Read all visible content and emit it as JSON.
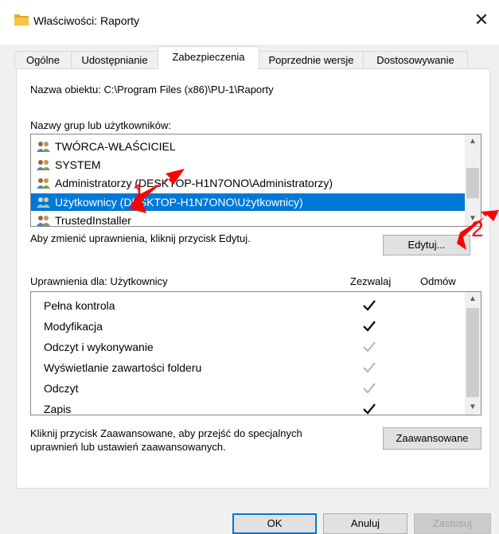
{
  "window": {
    "title": "Właściwości: Raporty",
    "close_glyph": "✕"
  },
  "tabs": [
    {
      "label": "Ogólne"
    },
    {
      "label": "Udostępnianie"
    },
    {
      "label": "Zabezpieczenia"
    },
    {
      "label": "Poprzednie wersje"
    },
    {
      "label": "Dostosowywanie"
    }
  ],
  "object_name": "Nazwa obiektu:  C:\\Program Files (x86)\\PU-1\\Raporty",
  "groups_label": "Nazwy grup lub użytkowników:",
  "groups": [
    {
      "name": "TWÓRCA-WŁAŚCICIEL",
      "icon": "users-icon"
    },
    {
      "name": "SYSTEM",
      "icon": "users-icon"
    },
    {
      "name": "Administratorzy (DESKTOP-H1N7ONO\\Administratorzy)",
      "icon": "users-icon"
    },
    {
      "name": "Użytkownicy (DESKTOP-H1N7ONO\\Użytkownicy)",
      "icon": "users-icon",
      "selected": true
    },
    {
      "name": "TrustedInstaller",
      "icon": "users-icon"
    }
  ],
  "change_hint": "Aby zmienić uprawnienia, kliknij przycisk Edytuj.",
  "edit_button": "Edytuj...",
  "perm_header": {
    "for_label": "Uprawnienia dla: Użytkownicy",
    "allow": "Zezwalaj",
    "deny": "Odmów"
  },
  "permissions": [
    {
      "name": "Pełna kontrola",
      "allow": "checked"
    },
    {
      "name": "Modyfikacja",
      "allow": "checked"
    },
    {
      "name": "Odczyt i wykonywanie",
      "allow": "inherited"
    },
    {
      "name": "Wyświetlanie zawartości folderu",
      "allow": "inherited"
    },
    {
      "name": "Odczyt",
      "allow": "inherited"
    },
    {
      "name": "Zapis",
      "allow": "checked"
    }
  ],
  "advanced_hint_line1": "Kliknij przycisk Zaawansowane, aby przejść do specjalnych",
  "advanced_hint_line2": "uprawnień lub ustawień zaawansowanych.",
  "advanced_button": "Zaawansowane",
  "footer": {
    "ok": "OK",
    "cancel": "Anuluj",
    "apply": "Zastosuj"
  },
  "annotations": [
    {
      "number": "1",
      "color": "#ff0000"
    },
    {
      "number": "2",
      "color": "#ff0000"
    }
  ],
  "colors": {
    "selection": "#0078d7",
    "annotation": "#ff0000",
    "dialog_bg": "#f0f0f0"
  }
}
